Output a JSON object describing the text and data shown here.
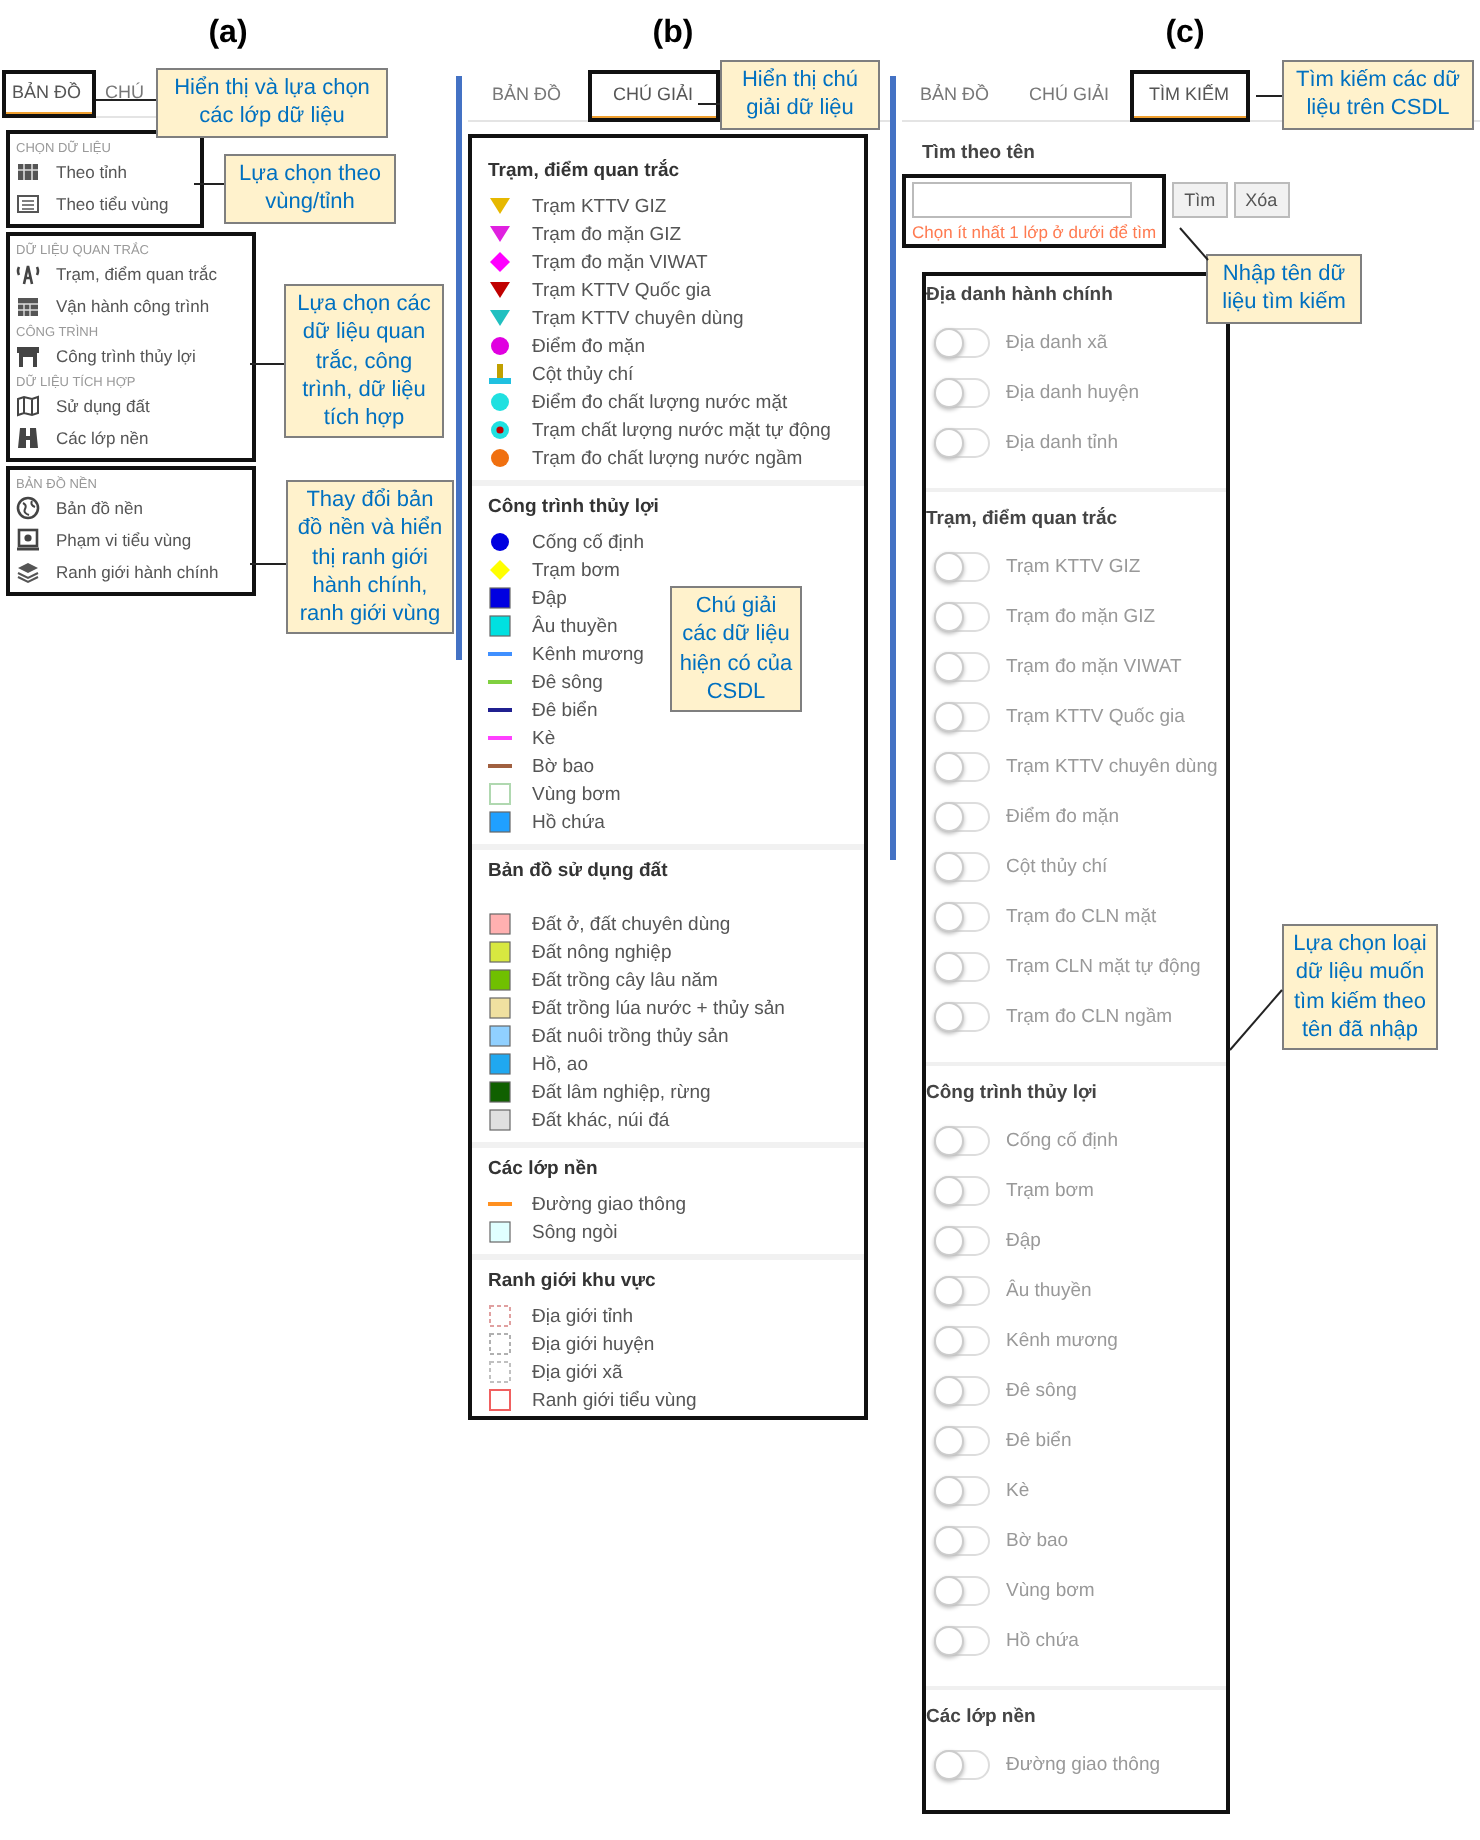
{
  "panel_a": {
    "label": "(a)",
    "tabs": [
      {
        "label": "BẢN ĐỒ",
        "selected": true
      },
      {
        "label": "CHÚ",
        "selected": false
      }
    ],
    "frames": [
      {
        "sections": [
          {
            "title": "CHỌN DỮ LIỆU",
            "items": [
              "Theo tỉnh",
              "Theo tiểu vùng"
            ]
          }
        ]
      },
      {
        "sections": [
          {
            "title": "DỮ LIỆU QUAN TRẮC",
            "items": [
              "Trạm, điểm quan trắc",
              "Vận hành công trình"
            ]
          },
          {
            "title": "CÔNG TRÌNH",
            "items": [
              "Công trình thủy lợi"
            ]
          },
          {
            "title": "DỮ LIỆU TÍCH HỢP",
            "items": [
              "Sử dụng đất",
              "Các lớp nền"
            ]
          }
        ]
      },
      {
        "sections": [
          {
            "title": "BẢN ĐỒ NỀN",
            "items": [
              "Bản đồ nền",
              "Phạm vi tiểu vùng",
              "Ranh giới hành chính"
            ]
          }
        ]
      }
    ],
    "callouts": [
      "Hiển thị và lựa chọn các lớp dữ liệu",
      "Lựa chọn theo vùng/tỉnh",
      "Lựa chọn các dữ liệu quan trắc, công trình, dữ liệu tích hợp",
      "Thay đổi bản đồ nền và hiển thị ranh giới hành chính, ranh giới vùng"
    ]
  },
  "panel_b": {
    "label": "(b)",
    "tabs": [
      {
        "label": "BẢN ĐỒ",
        "selected": false
      },
      {
        "label": "CHÚ GIẢI",
        "selected": true
      }
    ],
    "legend": [
      {
        "title": "Trạm, điểm quan trắc",
        "items": [
          {
            "label": "Trạm KTTV GIZ",
            "kind": "triangle",
            "color": "#e6b800"
          },
          {
            "label": "Trạm đo mặn GIZ",
            "kind": "triangle",
            "color": "#e020e0"
          },
          {
            "label": "Trạm đo mặn VIWAT",
            "kind": "diamond",
            "color": "#ff00ff"
          },
          {
            "label": "Trạm KTTV Quốc gia",
            "kind": "triangle",
            "color": "#c00000"
          },
          {
            "label": "Trạm KTTV chuyên dùng",
            "kind": "triangle",
            "color": "#20c0c0"
          },
          {
            "label": "Điểm đo mặn",
            "kind": "circle",
            "color": "#e000e0"
          },
          {
            "label": "Cột thủy chí",
            "kind": "gauge",
            "color": "#c0a000"
          },
          {
            "label": "Điểm đo chất lượng nước mặt",
            "kind": "circle",
            "color": "#20e0e0"
          },
          {
            "label": "Trạm chất lượng nước mặt tự động",
            "kind": "ringdot",
            "color": "#20e0e0"
          },
          {
            "label": "Trạm đo chất lượng nước ngầm",
            "kind": "circle",
            "color": "#f07010"
          }
        ]
      },
      {
        "title": "Công trình thủy lợi",
        "items": [
          {
            "label": "Cống cố định",
            "kind": "circle",
            "color": "#0000e0"
          },
          {
            "label": "Trạm bơm",
            "kind": "diamond",
            "color": "#ffff00"
          },
          {
            "label": "Đập",
            "kind": "square",
            "color": "#0000e0"
          },
          {
            "label": "Âu thuyền",
            "kind": "square",
            "color": "#00e0e0"
          },
          {
            "label": "Kênh mương",
            "kind": "line",
            "color": "#4090ff"
          },
          {
            "label": "Đê sông",
            "kind": "line",
            "color": "#80d040"
          },
          {
            "label": "Đê biển",
            "kind": "line",
            "color": "#202090"
          },
          {
            "label": "Kè",
            "kind": "line",
            "color": "#ff40ff"
          },
          {
            "label": "Bờ bao",
            "kind": "line",
            "color": "#a06040"
          },
          {
            "label": "Vùng bơm",
            "kind": "outline",
            "color": "#b0d8b0"
          },
          {
            "label": "Hồ chứa",
            "kind": "square",
            "color": "#20a0ff"
          }
        ]
      },
      {
        "title": "Bản đồ sử dụng đất",
        "items": [
          {
            "label": "Đất ở, đất chuyên dùng",
            "kind": "square",
            "color": "#ffb0b0"
          },
          {
            "label": "Đất nông nghiệp",
            "kind": "square",
            "color": "#d8e840"
          },
          {
            "label": "Đất trồng cây lâu năm",
            "kind": "square",
            "color": "#70c000"
          },
          {
            "label": "Đất trồng lúa nước + thủy sản",
            "kind": "square",
            "color": "#f0e0a0"
          },
          {
            "label": "Đất nuôi trồng thủy sản",
            "kind": "square",
            "color": "#90d0ff"
          },
          {
            "label": "Hồ, ao",
            "kind": "square",
            "color": "#20a8f0"
          },
          {
            "label": "Đất lâm nghiệp, rừng",
            "kind": "square",
            "color": "#106000"
          },
          {
            "label": "Đất khác, núi đá",
            "kind": "square",
            "color": "#e0e0e0"
          }
        ]
      },
      {
        "title": "Các lớp nền",
        "items": [
          {
            "label": "Đường giao thông",
            "kind": "line",
            "color": "#ff9020"
          },
          {
            "label": "Sông ngòi",
            "kind": "square",
            "color": "#e0ffff"
          }
        ]
      },
      {
        "title": "Ranh giới khu vực",
        "items": [
          {
            "label": "Địa giới tỉnh",
            "kind": "dashed",
            "color": "#e0a0a0"
          },
          {
            "label": "Địa giới huyện",
            "kind": "dashed",
            "color": "#b0b0b0"
          },
          {
            "label": "Địa giới xã",
            "kind": "dashed",
            "color": "#c0c0c0"
          },
          {
            "label": "Ranh giới tiểu vùng",
            "kind": "outline",
            "color": "#f06060"
          }
        ]
      }
    ],
    "callouts": [
      "Hiển thị chú giải dữ liệu",
      "Chú giải các dữ liệu hiện có của CSDL"
    ]
  },
  "panel_c": {
    "label": "(c)",
    "tabs": [
      {
        "label": "BẢN ĐỒ",
        "selected": false
      },
      {
        "label": "CHÚ GIẢI",
        "selected": false
      },
      {
        "label": "TÌM KIẾM",
        "selected": true
      }
    ],
    "search": {
      "label": "Tìm theo tên",
      "buttons": [
        "Tìm",
        "Xóa"
      ],
      "error": "Chọn ít nhất 1 lớp ở dưới để tìm"
    },
    "groups": [
      {
        "title": "Địa danh hành chính",
        "items": [
          {
            "label": "Địa danh xã",
            "on": false
          },
          {
            "label": "Địa danh huyện",
            "on": false
          },
          {
            "label": "Địa danh tỉnh",
            "on": false
          }
        ]
      },
      {
        "title": "Trạm, điểm quan trắc",
        "items": [
          {
            "label": "Trạm KTTV GIZ",
            "on": false
          },
          {
            "label": "Trạm đo mặn GIZ",
            "on": false
          },
          {
            "label": "Trạm đo mặn VIWAT",
            "on": false
          },
          {
            "label": "Trạm KTTV Quốc gia",
            "on": false
          },
          {
            "label": "Trạm KTTV chuyên dùng",
            "on": false
          },
          {
            "label": "Điểm đo mặn",
            "on": false
          },
          {
            "label": "Cột thủy chí",
            "on": false
          },
          {
            "label": "Trạm đo CLN mặt",
            "on": false
          },
          {
            "label": "Trạm CLN mặt tự động",
            "on": false
          },
          {
            "label": "Trạm đo CLN ngầm",
            "on": false
          }
        ]
      },
      {
        "title": "Công trình thủy lợi",
        "items": [
          {
            "label": "Cống cố định",
            "on": false
          },
          {
            "label": "Trạm bơm",
            "on": false
          },
          {
            "label": "Đập",
            "on": false
          },
          {
            "label": "Âu thuyền",
            "on": false
          },
          {
            "label": "Kênh mương",
            "on": false
          },
          {
            "label": "Đê sông",
            "on": false
          },
          {
            "label": "Đê biển",
            "on": false
          },
          {
            "label": "Kè",
            "on": false
          },
          {
            "label": "Bờ bao",
            "on": false
          },
          {
            "label": "Vùng bơm",
            "on": false
          },
          {
            "label": "Hồ chứa",
            "on": false
          }
        ]
      },
      {
        "title": "Các lớp nền",
        "items": [
          {
            "label": "Đường giao thông",
            "on": false
          }
        ]
      }
    ],
    "callouts": [
      "Tìm kiếm các dữ liệu trên CSDL",
      "Nhập tên dữ liệu tìm kiếm",
      "Lựa chọn loại dữ liệu muốn tìm kiếm theo tên đã nhập"
    ]
  }
}
